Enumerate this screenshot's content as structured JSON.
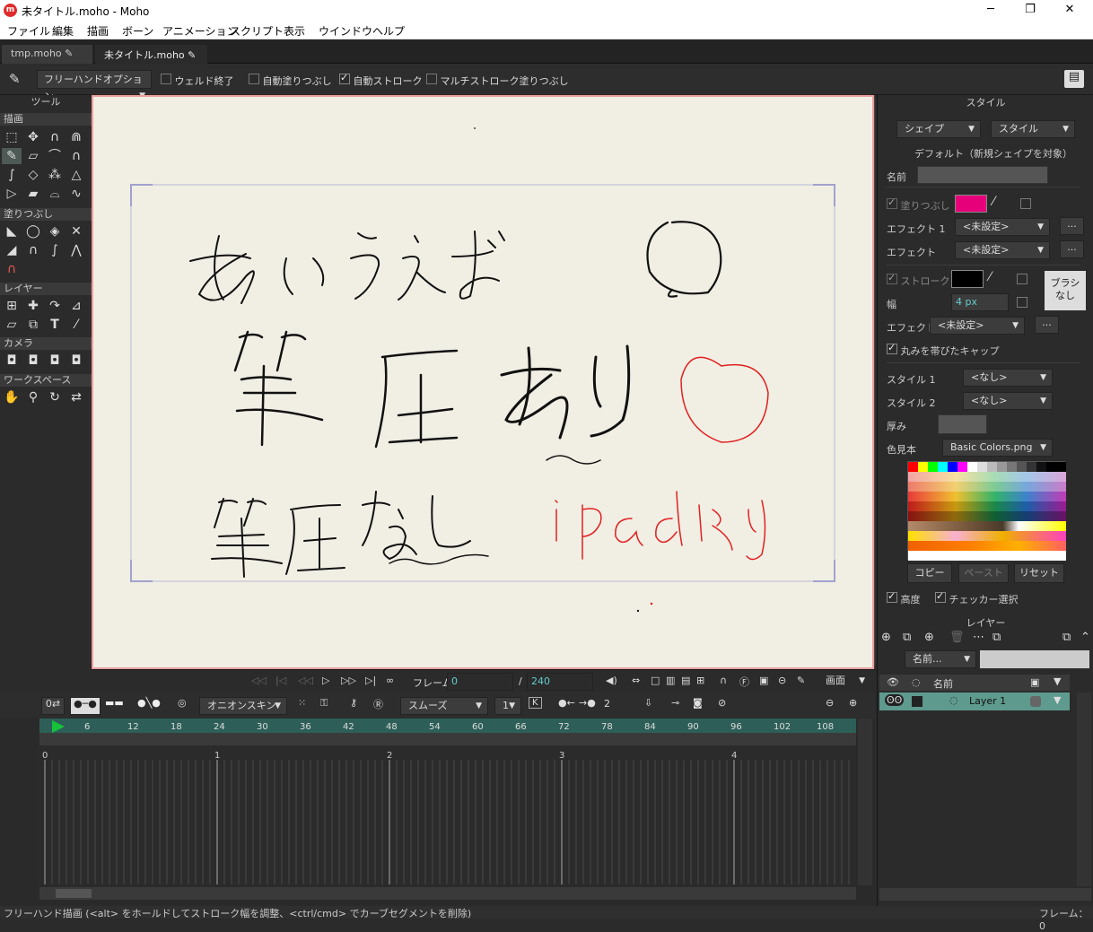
{
  "window": {
    "title": "未タイトル.moho - Moho",
    "logo_text": "m",
    "min_label": "─",
    "max_label": "❐",
    "close_label": "✕"
  },
  "menu": [
    "ファイル",
    "編集",
    "描画",
    "ボーン",
    "アニメーション",
    "スクリプト",
    "表示",
    "ウインドウ",
    "ヘルプ"
  ],
  "tabs": [
    {
      "label": "tmp.moho"
    },
    {
      "label": "未タイトル.moho"
    }
  ],
  "options": {
    "tool_dropdown": "フリーハンドオプション",
    "weld_end": "ウェルド終了",
    "auto_fill": "自動塗りつぶし",
    "auto_stroke": "自動ストローク",
    "multi_stroke_fill": "マルチストローク塗りつぶし"
  },
  "tools_panel": {
    "header": "ツール",
    "sections": {
      "draw": "描画",
      "fill": "塗りつぶし",
      "layer": "レイヤー",
      "camera": "カメラ",
      "workspace": "ワークスペース"
    }
  },
  "style_panel": {
    "header": "スタイル",
    "shape_dd": "シェイプ",
    "style_dd": "スタイル",
    "default_label": "デフォルト（新規シェイプを対象）",
    "name_label": "名前",
    "fill_label": "塗りつぶし",
    "fill_color": "#e6007a",
    "effect1_label": "エフェクト 1",
    "effect1_value": "<未設定>",
    "effect2_label": "エフェクト",
    "effect2_value": "<未設定>",
    "more": "...",
    "stroke_label": "ストローク",
    "stroke_color": "#000000",
    "brush_label": "ブラシ\nなし",
    "width_label": "幅",
    "width_value": "4 px",
    "effect3_label": "エフェクト",
    "effect3_value": "<未設定>",
    "round_cap": "丸みを帯びたキャップ",
    "style1_label": "スタイル 1",
    "style1_value": "<なし>",
    "style2_label": "スタイル 2",
    "style2_value": "<なし>",
    "thickness_label": "厚み",
    "swatch_label": "色見本",
    "swatch_value": "Basic Colors.png",
    "copy": "コピー",
    "paste": "ペースト",
    "reset": "リセット",
    "advanced": "高度",
    "checker": "チェッカー選択"
  },
  "playbar": {
    "frame_label": "フレーム",
    "frame_value": "0",
    "slash": "/",
    "total": "240",
    "view_dd": "画面"
  },
  "timeline": {
    "onion": "オニオンスキン",
    "smooth": "スムーズ",
    "smooth_val": "1",
    "step": "2",
    "ticks": [
      "0",
      "6",
      "12",
      "18",
      "24",
      "30",
      "36",
      "42",
      "48",
      "54",
      "60",
      "66",
      "72",
      "78",
      "84",
      "90",
      "96",
      "102",
      "108"
    ],
    "seconds": [
      "0",
      "1",
      "2",
      "3",
      "4"
    ]
  },
  "layer_panel": {
    "header": "レイヤー",
    "name_dd": "名前...",
    "col_name": "名前",
    "layer_name": "Layer 1"
  },
  "status": {
    "text": "フリーハンド描画 (<alt> をホールドしてストローク幅を調整、<ctrl/cmd> でカーブセグメントを削除)",
    "frame": "フレーム：0"
  },
  "canvas_text": [
    "あいうえお",
    "筆圧あり",
    "筆圧なし",
    "iPadより"
  ]
}
